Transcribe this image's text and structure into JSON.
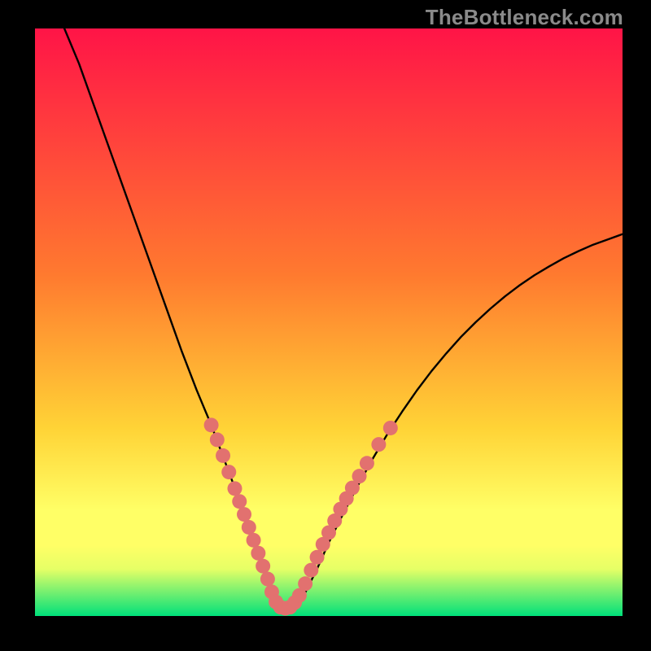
{
  "watermark": "TheBottleneck.com",
  "colors": {
    "gradient_top": "#ff1447",
    "gradient_mid1": "#ff7a2f",
    "gradient_mid2": "#ffd336",
    "gradient_band": "#ffff66",
    "gradient_bottom_band_top": "#e6ff66",
    "gradient_bottom": "#00e07a",
    "curve": "#000000",
    "dots": "#e2716f",
    "frame": "#000000"
  },
  "chart_data": {
    "type": "line",
    "title": "",
    "xlabel": "",
    "ylabel": "",
    "xlim": [
      0,
      100
    ],
    "ylim": [
      0,
      100
    ],
    "series": [
      {
        "name": "bottleneck-curve",
        "x": [
          5,
          7.5,
          10,
          12.5,
          15,
          17.5,
          20,
          22.5,
          25,
          27.5,
          30,
          31.5,
          33,
          34.5,
          36,
          37,
          38,
          39,
          40,
          41,
          42,
          43,
          44.5,
          46,
          48,
          50,
          52.5,
          55,
          57.5,
          60,
          62.5,
          65,
          67.5,
          70,
          72.5,
          75,
          77.5,
          80,
          82.5,
          85,
          87.5,
          90,
          92.5,
          95,
          97.5,
          100
        ],
        "values": [
          100,
          94,
          87,
          80,
          73,
          66,
          59,
          52,
          45,
          38.5,
          32.5,
          28.5,
          24.5,
          20.5,
          16.5,
          13.5,
          10.5,
          7.5,
          4.5,
          2.2,
          1.3,
          1.3,
          2.0,
          4.0,
          8.0,
          12.5,
          17.5,
          22.3,
          26.8,
          31.0,
          34.8,
          38.4,
          41.7,
          44.7,
          47.5,
          50.0,
          52.3,
          54.4,
          56.3,
          58.0,
          59.5,
          60.9,
          62.1,
          63.2,
          64.1,
          65.0
        ]
      }
    ],
    "overlay_points": {
      "name": "highlight-dots",
      "points": [
        {
          "x": 30.0,
          "y": 32.5
        },
        {
          "x": 31.0,
          "y": 30.0
        },
        {
          "x": 32.0,
          "y": 27.3
        },
        {
          "x": 33.0,
          "y": 24.5
        },
        {
          "x": 34.0,
          "y": 21.7
        },
        {
          "x": 34.8,
          "y": 19.5
        },
        {
          "x": 35.6,
          "y": 17.3
        },
        {
          "x": 36.4,
          "y": 15.1
        },
        {
          "x": 37.2,
          "y": 12.9
        },
        {
          "x": 38.0,
          "y": 10.7
        },
        {
          "x": 38.8,
          "y": 8.5
        },
        {
          "x": 39.6,
          "y": 6.3
        },
        {
          "x": 40.3,
          "y": 4.1
        },
        {
          "x": 41.0,
          "y": 2.4
        },
        {
          "x": 41.8,
          "y": 1.5
        },
        {
          "x": 42.6,
          "y": 1.3
        },
        {
          "x": 43.4,
          "y": 1.5
        },
        {
          "x": 44.2,
          "y": 2.3
        },
        {
          "x": 45.0,
          "y": 3.5
        },
        {
          "x": 46.0,
          "y": 5.5
        },
        {
          "x": 47.0,
          "y": 7.8
        },
        {
          "x": 48.0,
          "y": 10.0
        },
        {
          "x": 49.0,
          "y": 12.2
        },
        {
          "x": 50.0,
          "y": 14.2
        },
        {
          "x": 51.0,
          "y": 16.2
        },
        {
          "x": 52.0,
          "y": 18.2
        },
        {
          "x": 53.0,
          "y": 20.0
        },
        {
          "x": 54.0,
          "y": 21.8
        },
        {
          "x": 55.2,
          "y": 23.8
        },
        {
          "x": 56.5,
          "y": 26.0
        },
        {
          "x": 58.5,
          "y": 29.2
        },
        {
          "x": 60.5,
          "y": 32.0
        }
      ]
    }
  }
}
